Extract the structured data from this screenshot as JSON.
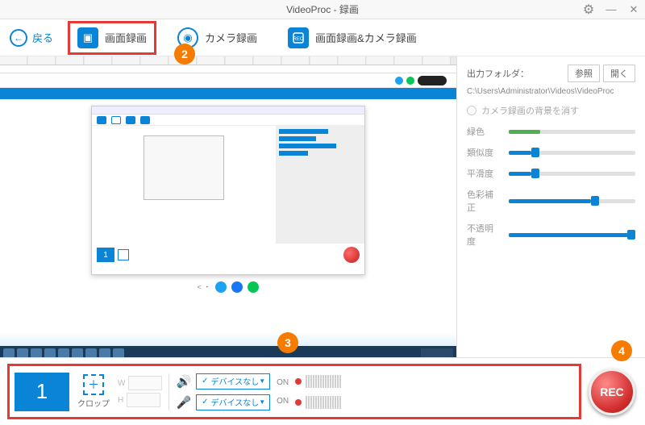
{
  "titlebar": {
    "title": "VideoProc - 録画"
  },
  "toolbar": {
    "back": "戻る",
    "modes": {
      "screen": "画面録画",
      "camera": "カメラ録画",
      "both": "画面録画&カメラ録画"
    }
  },
  "markers": {
    "m2": "2",
    "m3": "3",
    "m4": "4"
  },
  "side": {
    "folder_label": "出力フォルダ：",
    "browse": "参照",
    "open": "開く",
    "path": "C:\\Users\\Administrator\\Videos\\VideoProc",
    "chroma_chk": "カメラ録画の背景を消す",
    "sliders": {
      "chroma": {
        "label": "緑色",
        "pct": 25
      },
      "similar": {
        "label": "類似度",
        "pct": 18
      },
      "smooth": {
        "label": "平滑度",
        "pct": 18
      },
      "spill": {
        "label": "色彩補正",
        "pct": 65
      },
      "opacity": {
        "label": "不透明度",
        "pct": 100
      }
    }
  },
  "bottom": {
    "one": "1",
    "crop": "クロップ",
    "w_label": "W",
    "h_label": "H",
    "w_val": "",
    "h_val": "",
    "device_none": "デバイスなし",
    "on": "ON",
    "rec": "REC"
  }
}
